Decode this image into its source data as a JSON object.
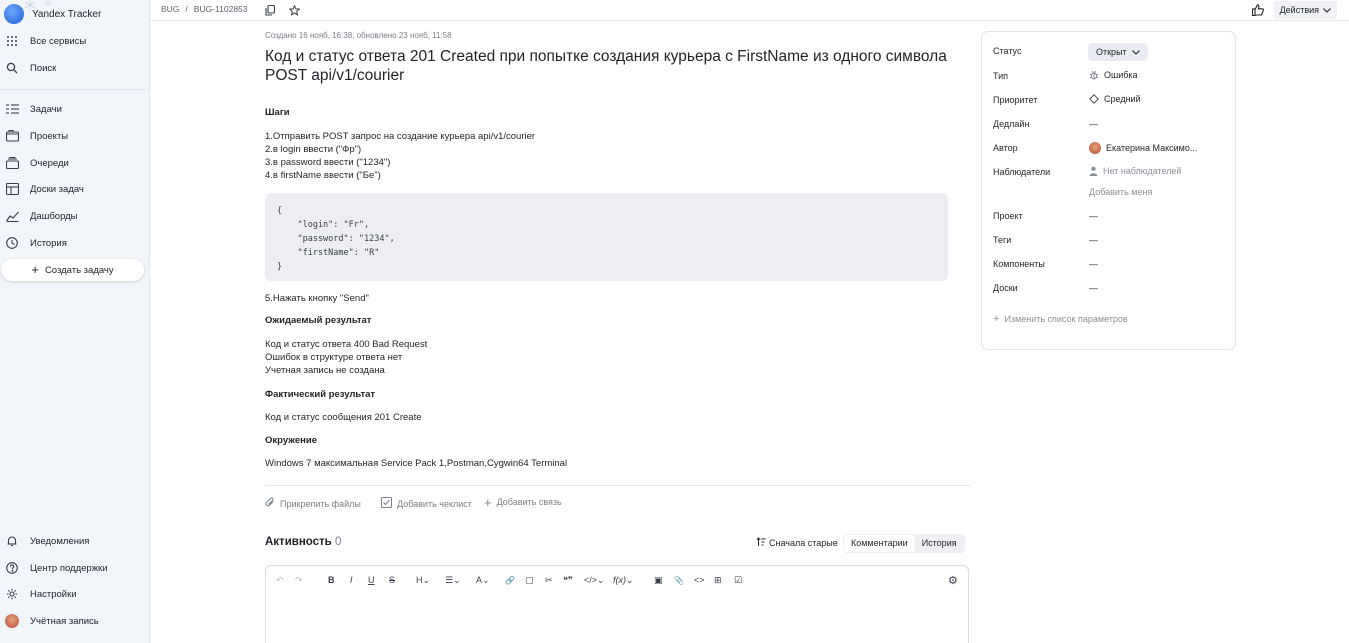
{
  "app": {
    "name": "Yandex Tracker"
  },
  "sidebar": {
    "top_items": [
      {
        "label": "Все сервисы",
        "icon": "grid-icon"
      },
      {
        "label": "Поиск",
        "icon": "search-icon"
      }
    ],
    "items": [
      {
        "label": "Задачи",
        "icon": "tasks-icon"
      },
      {
        "label": "Проекты",
        "icon": "projects-icon"
      },
      {
        "label": "Очереди",
        "icon": "queues-icon"
      },
      {
        "label": "Доски задач",
        "icon": "boards-icon"
      },
      {
        "label": "Дашборды",
        "icon": "dashboards-icon"
      },
      {
        "label": "История",
        "icon": "history-icon"
      }
    ],
    "create_label": "Создать задачу",
    "bottom_items": [
      {
        "label": "Уведомления",
        "icon": "bell-icon"
      },
      {
        "label": "Центр поддержки",
        "icon": "help-icon"
      },
      {
        "label": "Настройки",
        "icon": "gear-icon"
      },
      {
        "label": "Учётная запись",
        "icon": "avatar"
      }
    ]
  },
  "topbar": {
    "breadcrumb_queue": "BUG",
    "breadcrumb_sep": "/",
    "breadcrumb_issue": "BUG-1102853",
    "actions_label": "Действия"
  },
  "issue": {
    "meta": "Создано 16 нояб, 16:38, обновлено 23 нояб, 11:58",
    "title": "Код и статус ответа 201 Created при попытке создания курьера с FirstName из одного символа POST api/v1/courier",
    "steps_heading": "Шаги",
    "steps": [
      "1.Отправить POST запрос на создание курьера api/v1/courier",
      "2.в login ввести (\"Фр\")",
      "3.в password ввести (\"1234\")",
      "4.в firstName ввести (\"Бе\")"
    ],
    "code": "{\n    \"login\": \"Fr\",\n    \"password\": \"1234\",\n    \"firstName\": \"R\"\n}",
    "step5": "5.Нажать кнопку \"Send\"",
    "expected_heading": "Ожидаемый результат",
    "expected": [
      "Код и статус ответа 400 Bad Request",
      "Ошибок в структуре ответа нет",
      "Учетная запись не создана"
    ],
    "actual_heading": "Фактический результат",
    "actual": "Код и статус сообщения 201 Create",
    "env_heading": "Окружение",
    "env": "Windows 7 максимальная Service Pack 1,Postman,Cygwin64 Terminal"
  },
  "attach_actions": {
    "files": "Прикрепить файлы",
    "checklist": "Добавить чеклист",
    "link": "Добавить связь"
  },
  "activity": {
    "label": "Активность",
    "count": "0",
    "sort_label": "Сначала старые",
    "tab_comments": "Комментарии",
    "tab_history": "История"
  },
  "editor_toolbar": {
    "undo": "↶",
    "redo": "↷",
    "bold": "B",
    "italic": "I",
    "underline": "U",
    "strike": "S",
    "heading": "H",
    "list": "☰",
    "color": "A",
    "link": "🔗",
    "note": "▢",
    "cut": "✂",
    "quote": "❝❞",
    "code_block": "</>",
    "formula": "f(x)",
    "image": "▣",
    "attach": "📎",
    "code": "<>",
    "table": "⊞",
    "checkbox": "☑",
    "settings": "⚙"
  },
  "panel": {
    "status_label": "Статус",
    "status_value": "Открыт",
    "type_label": "Тип",
    "type_value": "Ошибка",
    "priority_label": "Приоритет",
    "priority_value": "Средний",
    "deadline_label": "Дедлайн",
    "deadline_value": "—",
    "author_label": "Автор",
    "author_value": "Екатерина Максимо...",
    "watchers_label": "Наблюдатели",
    "watchers_value": "Нет наблюдателей",
    "add_me": "Добавить меня",
    "project_label": "Проект",
    "project_value": "—",
    "tags_label": "Теги",
    "tags_value": "—",
    "components_label": "Компоненты",
    "components_value": "—",
    "boards_label": "Доски",
    "boards_value": "—",
    "edit_params": "Изменить список параметров"
  }
}
